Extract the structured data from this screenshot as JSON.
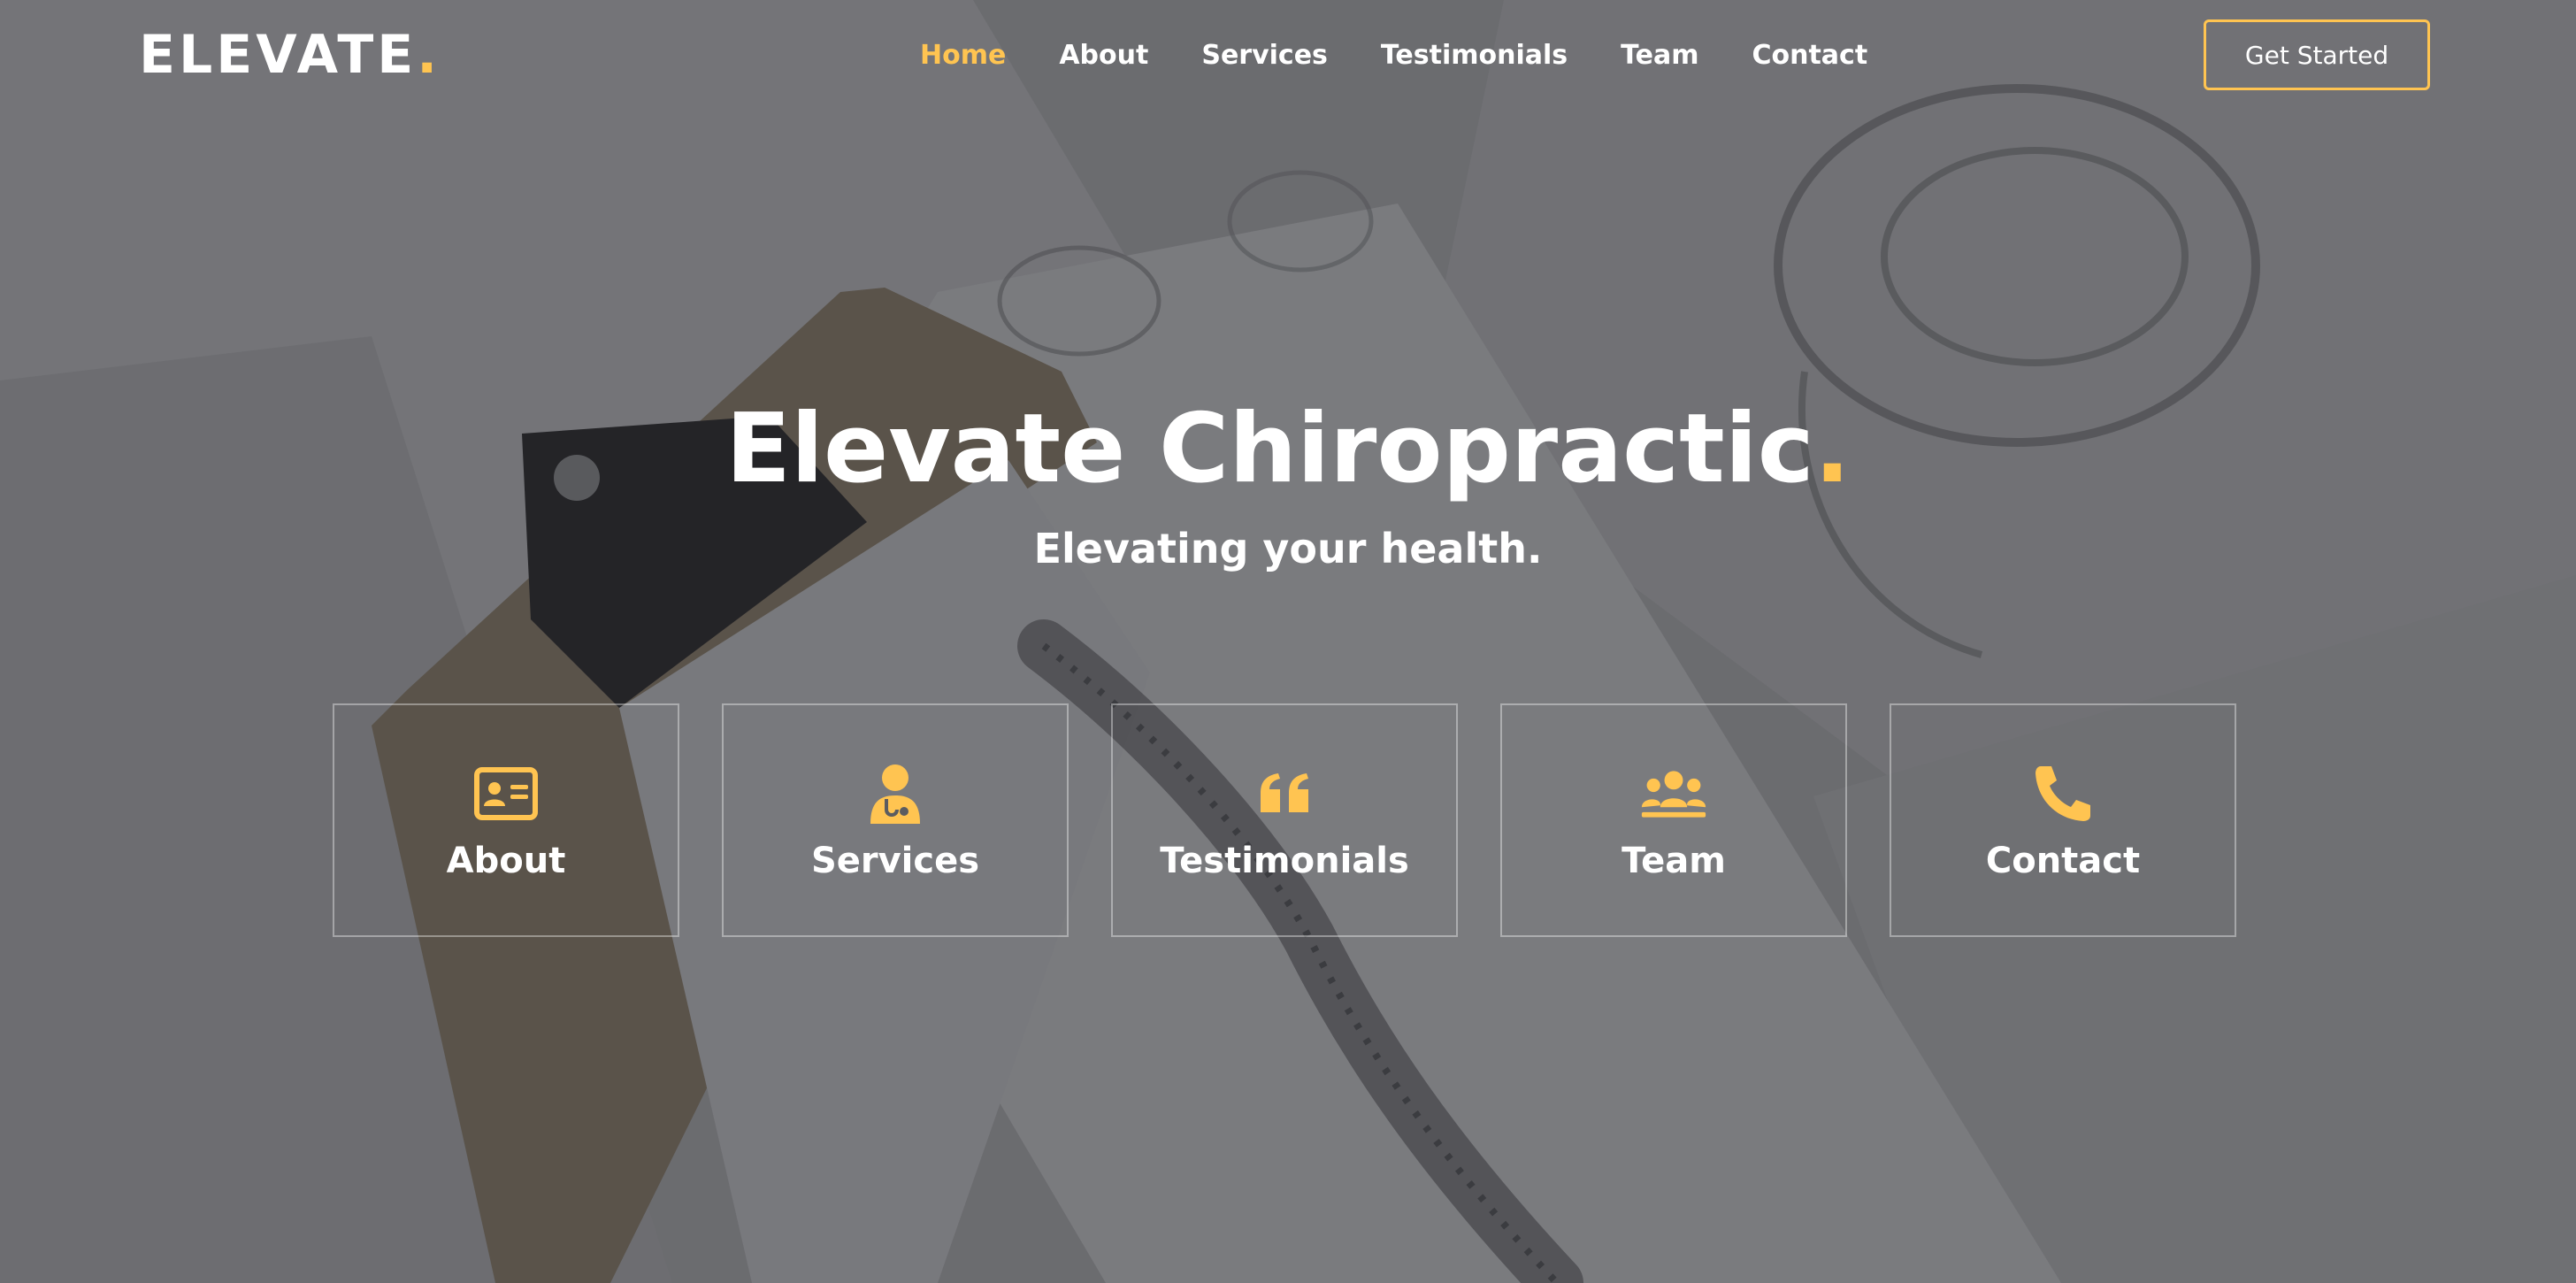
{
  "brand": {
    "name": "ELEVATE",
    "dot": ".",
    "accent_color": "#ffc451"
  },
  "nav": {
    "items": [
      {
        "label": "Home",
        "active": true
      },
      {
        "label": "About",
        "active": false
      },
      {
        "label": "Services",
        "active": false
      },
      {
        "label": "Testimonials",
        "active": false
      },
      {
        "label": "Team",
        "active": false
      },
      {
        "label": "Contact",
        "active": false
      }
    ],
    "cta_label": "Get Started"
  },
  "hero": {
    "title": "Elevate Chiropractic",
    "title_dot": ".",
    "subtitle": "Elevating your health."
  },
  "boxes": [
    {
      "label": "About",
      "icon": "id-card-icon"
    },
    {
      "label": "Services",
      "icon": "doctor-icon"
    },
    {
      "label": "Testimonials",
      "icon": "quote-icon"
    },
    {
      "label": "Team",
      "icon": "people-group-icon"
    },
    {
      "label": "Contact",
      "icon": "phone-icon"
    }
  ]
}
